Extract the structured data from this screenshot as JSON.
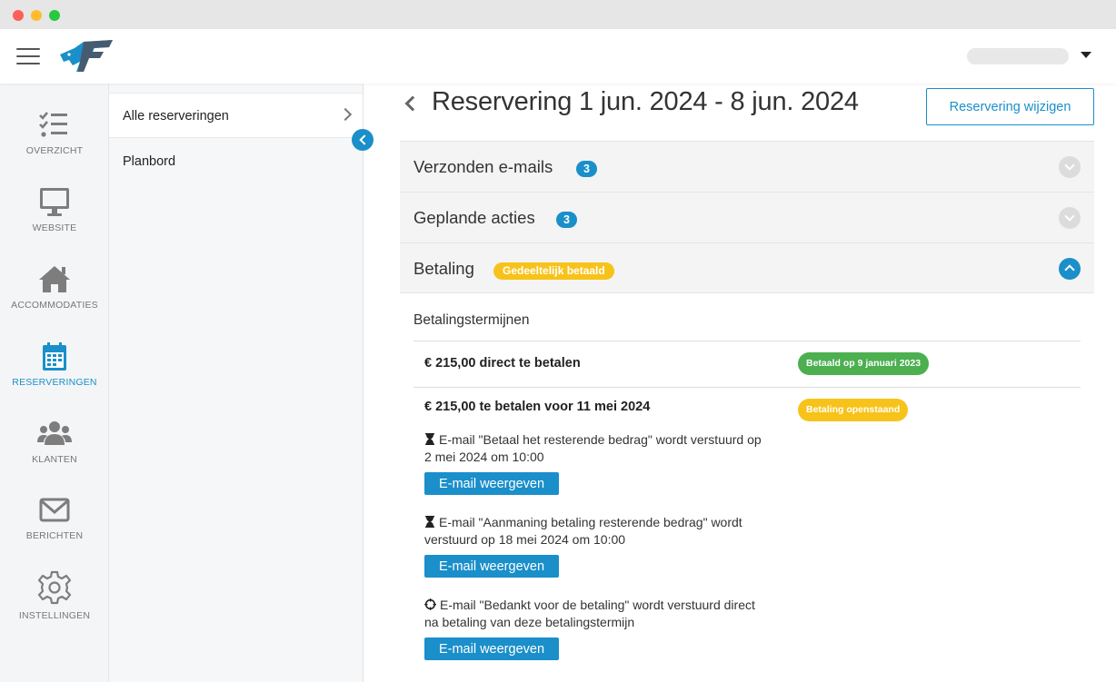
{
  "header": {
    "menu_icon": "hamburger-icon",
    "logo_icon": "eagle-logo-icon",
    "user_caret_icon": "caret-down-icon"
  },
  "sidebar": {
    "items": [
      {
        "label": "OVERZICHT",
        "icon": "checklist-icon"
      },
      {
        "label": "WEBSITE",
        "icon": "monitor-icon"
      },
      {
        "label": "ACCOMMODATIES",
        "icon": "house-icon"
      },
      {
        "label": "RESERVERINGEN",
        "icon": "calendar-icon",
        "active": true
      },
      {
        "label": "KLANTEN",
        "icon": "users-icon"
      },
      {
        "label": "BERICHTEN",
        "icon": "envelope-icon"
      },
      {
        "label": "INSTELLINGEN",
        "icon": "gear-icon"
      }
    ]
  },
  "subnav": {
    "items": [
      {
        "label": "Alle reserveringen"
      },
      {
        "label": "Planbord"
      }
    ]
  },
  "main": {
    "title": "Reservering 1 jun. 2024 - 8 jun. 2024",
    "edit_button": "Reservering wijzigen",
    "accordions": [
      {
        "title": "Verzonden e-mails",
        "count": "3"
      },
      {
        "title": "Geplande acties",
        "count": "3"
      },
      {
        "title": "Betaling",
        "status": "Gedeeltelijk betaald"
      }
    ],
    "payment": {
      "heading": "Betalingstermijnen",
      "terms": [
        {
          "text": "€ 215,00 direct te betalen",
          "status": "Betaald op 9 januari 2023"
        },
        {
          "text": "€ 215,00 te betalen voor 11 mei 2024",
          "status": "Betaling openstaand"
        }
      ],
      "emails": [
        {
          "icon": "hourglass-icon",
          "text": "E-mail \"Betaal het resterende bedrag\" wordt verstuurd op 2 mei 2024 om 10:00",
          "button": "E-mail weergeven"
        },
        {
          "icon": "hourglass-icon",
          "text": "E-mail \"Aanmaning betaling resterende bedrag\" wordt verstuurd op 18 mei 2024 om 10:00",
          "button": "E-mail weergeven"
        },
        {
          "icon": "crosshair-icon",
          "text": "E-mail \"Bedankt voor de betaling\" wordt verstuurd direct na betaling van deze betalingstermijn",
          "button": "E-mail weergeven"
        }
      ]
    }
  },
  "colors": {
    "accent": "#1a8fca",
    "paid": "#4caf50",
    "pending": "#f7c31a",
    "icon_gray": "#7d7d7d"
  }
}
